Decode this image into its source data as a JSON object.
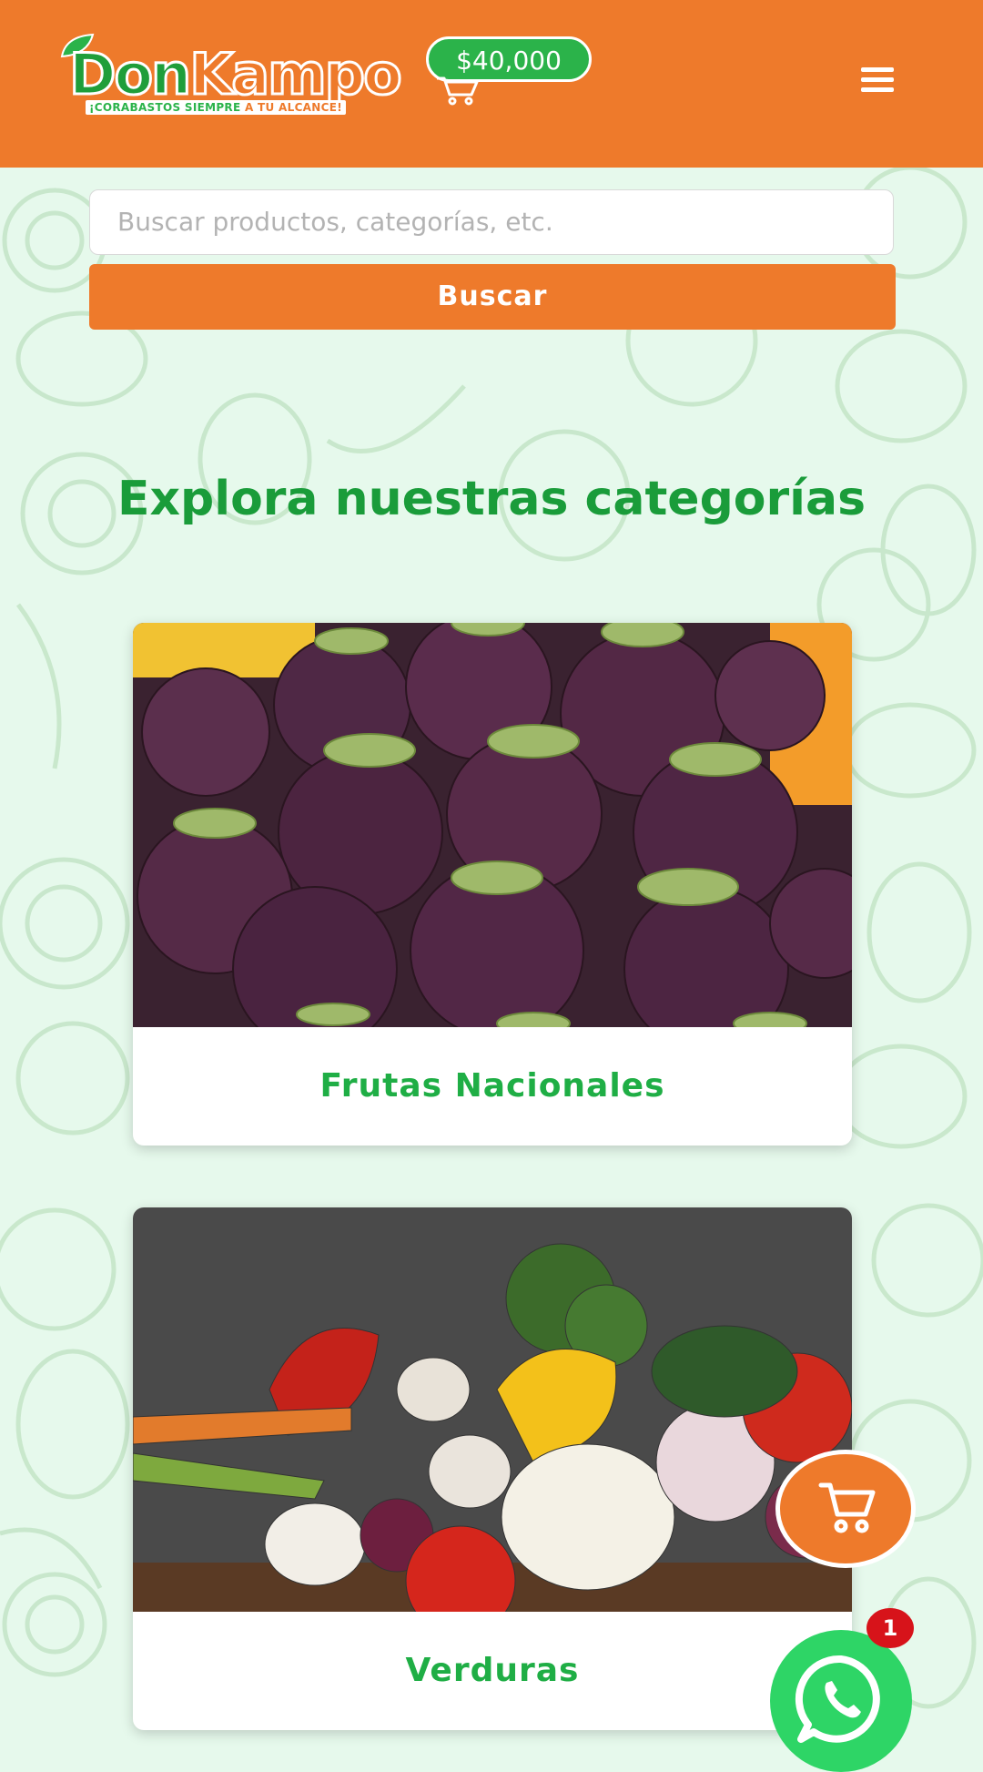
{
  "header": {
    "logo_don": "Don",
    "logo_kampo": "Kampo",
    "logo_tagline": "¡CORABASTOS SIEMPRE",
    "logo_tagline_highlight": "A TU ALCANCE!",
    "cart_total": "$40,000",
    "menu_icon": "hamburger-menu-icon",
    "cart_icon": "shopping-cart-icon"
  },
  "search": {
    "placeholder": "Buscar productos, categorías, etc.",
    "button_label": "Buscar"
  },
  "categories_section": {
    "title": "Explora nuestras categorías",
    "items": [
      {
        "label": "Frutas Nacionales",
        "image": "mangosteen-fruit-photo"
      },
      {
        "label": "Verduras",
        "image": "vegetables-photo"
      }
    ]
  },
  "floating": {
    "cart_icon": "shopping-cart-icon",
    "whatsapp_icon": "whatsapp-icon",
    "whatsapp_badge": "1"
  },
  "colors": {
    "brand_orange": "#ee7a2b",
    "brand_green": "#1a9c3a",
    "background_mint": "#e6f9ec",
    "whatsapp_green": "#2ed566",
    "badge_red": "#d7131a"
  }
}
